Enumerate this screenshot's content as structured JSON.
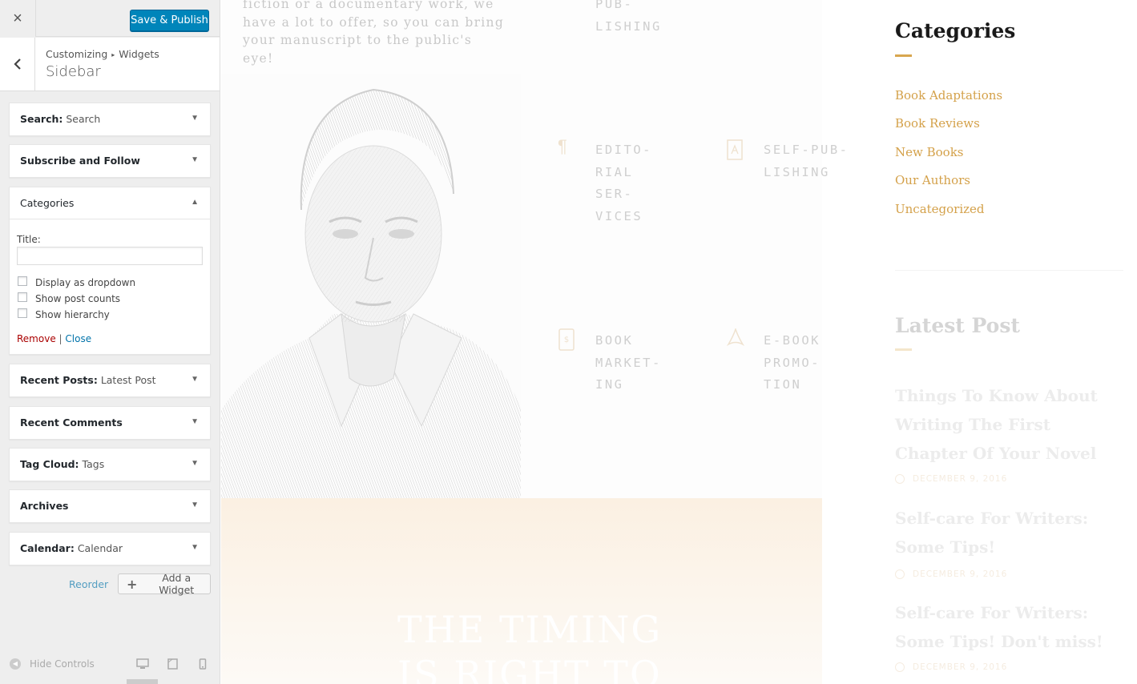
{
  "header": {
    "close_label": "×",
    "publish_label": "Save & Publish"
  },
  "section": {
    "back_label": "‹",
    "breadcrumb_parent": "Customizing",
    "breadcrumb_sep": "▸",
    "breadcrumb_current": "Widgets",
    "title": "Sidebar"
  },
  "widgets": [
    {
      "name": "Search:",
      "subtitle": "Search"
    },
    {
      "name": "Subscribe and Follow",
      "subtitle": ""
    },
    {
      "name": "Categories",
      "subtitle": "",
      "expanded": true
    },
    {
      "name": "Recent Posts:",
      "subtitle": "Latest Post"
    },
    {
      "name": "Recent Comments",
      "subtitle": ""
    },
    {
      "name": "Tag Cloud:",
      "subtitle": "Tags"
    },
    {
      "name": "Archives",
      "subtitle": ""
    },
    {
      "name": "Calendar:",
      "subtitle": "Calendar"
    }
  ],
  "categories_widget": {
    "title_label": "Title:",
    "title_value": "",
    "checkboxes": [
      {
        "label": "Display as dropdown",
        "checked": false
      },
      {
        "label": "Show post counts",
        "checked": false
      },
      {
        "label": "Show hierarchy",
        "checked": false
      }
    ],
    "remove_label": "Remove",
    "separator": "|",
    "close_label": "Close"
  },
  "actions": {
    "reorder_label": "Reorder",
    "add_widget_label": "Add a Widget"
  },
  "footer": {
    "hide_controls_label": "Hide Controls"
  },
  "preview": {
    "hero_text": "fiction or a documentary work, we have a lot to offer, so you can bring your manuscript to the public's eye!",
    "services": {
      "publishing": "PUB-\nLISHING",
      "editorial": "EDITO-\nRIAL\nSER-\nVICES",
      "self_publishing": "SELF-PUB-\nLISHING",
      "marketing": "BOOK\nMARKET-\nING",
      "promotion": "E-BOOK\nPROMO-\nTION"
    },
    "band_text": "THE TIMING\nIS RIGHT TO",
    "sidebar": {
      "categories_heading": "Categories",
      "categories": [
        "Book Adaptations",
        "Book Reviews",
        "New Books",
        "Our Authors",
        "Uncategorized"
      ],
      "latest_heading": "Latest Post",
      "posts": [
        {
          "title": "Things To Know About Writing The First Chapter Of Your Novel",
          "date": "DECEMBER 9, 2016"
        },
        {
          "title": "Self-care For Writers: Some Tips!",
          "date": "DECEMBER 9, 2016"
        },
        {
          "title": "Self-care For Writers: Some Tips! Don't miss!",
          "date": "DECEMBER 9, 2016"
        }
      ]
    }
  },
  "colors": {
    "primary_button": "#0085ba",
    "accent": "#d4a14a",
    "remove_link": "#aa0000",
    "link": "#0073aa"
  }
}
